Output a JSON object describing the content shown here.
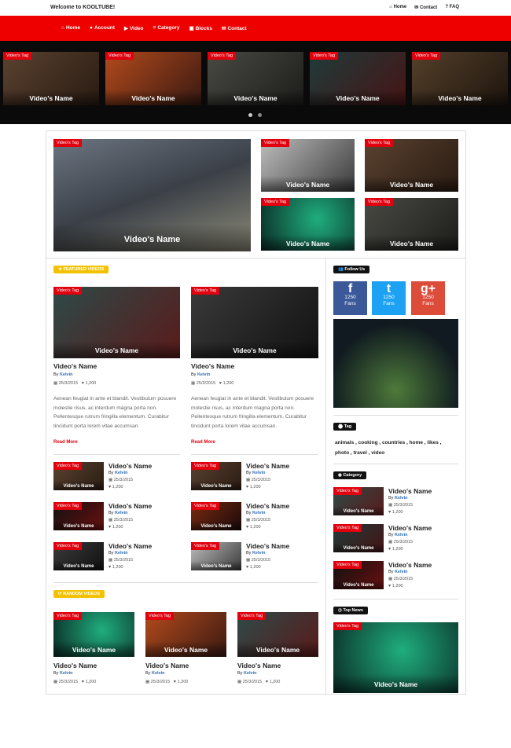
{
  "header": {
    "welcome": "Welcome to KOOLTUBE!",
    "links": [
      "Home",
      "Contact",
      "FAQ"
    ]
  },
  "nav": [
    "Home",
    "Account",
    "Video",
    "Category",
    "Blocks",
    "Contact"
  ],
  "tag_label": "Video's Tag",
  "video_name": "Video's Name",
  "featured_label": "FEATURED VIDEOS",
  "random_label": "RANDOM VIDEOS",
  "follow_label": "Follow Us",
  "tag_section": "Tag",
  "category_label": "Category",
  "top_news": "Top News",
  "post_title": "Video's Name",
  "by": "By",
  "author": "Kelvin",
  "date": "25/3/2015",
  "views": "1,200",
  "excerpt": "Aenean feugiat in ante et blandit. Vestibulum posuere molestie risus, ac interdum magna porta non. Pellentesque rutrum fringilla elementum. Curabitur tincidunt porta lorem vitae accumsan.",
  "read_more": "Read More",
  "social": [
    {
      "label": "1250",
      "sub": "Fans",
      "icon": "f",
      "color": "#3b5998"
    },
    {
      "label": "1250",
      "sub": "Fans",
      "icon": "t",
      "color": "#1da1f2"
    },
    {
      "label": "1250",
      "sub": "Fans",
      "icon": "g+",
      "color": "#dd4b39"
    }
  ],
  "tags": "animals ,   cooking ,   countries ,   home ,   likes ,   photo ,   travel ,   video"
}
